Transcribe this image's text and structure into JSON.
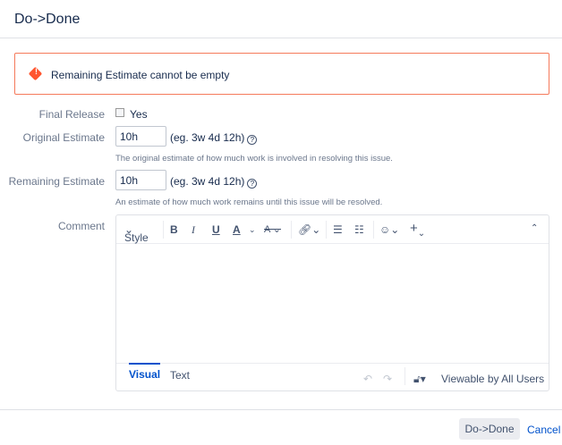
{
  "dialog": {
    "title": "Do->Done"
  },
  "error": {
    "message": "Remaining Estimate cannot be empty"
  },
  "fields": {
    "final_release": {
      "label": "Final Release",
      "option": "Yes",
      "checked": false
    },
    "original_estimate": {
      "label": "Original Estimate",
      "value": "10h",
      "hint": "(eg. 3w 4d 12h)",
      "help": "?",
      "description": "The original estimate of how much work is involved in resolving this issue."
    },
    "remaining_estimate": {
      "label": "Remaining Estimate",
      "value": "10h",
      "hint": "(eg. 3w 4d 12h)",
      "help": "?",
      "description": "An estimate of how much work remains until this issue will be resolved."
    },
    "comment": {
      "label": "Comment"
    }
  },
  "editor": {
    "style_label": "Style",
    "tabs": [
      "Visual",
      "Text"
    ],
    "visibility": "Viewable by All Users"
  },
  "footer": {
    "submit": "Do->Done",
    "cancel": "Cancel"
  }
}
